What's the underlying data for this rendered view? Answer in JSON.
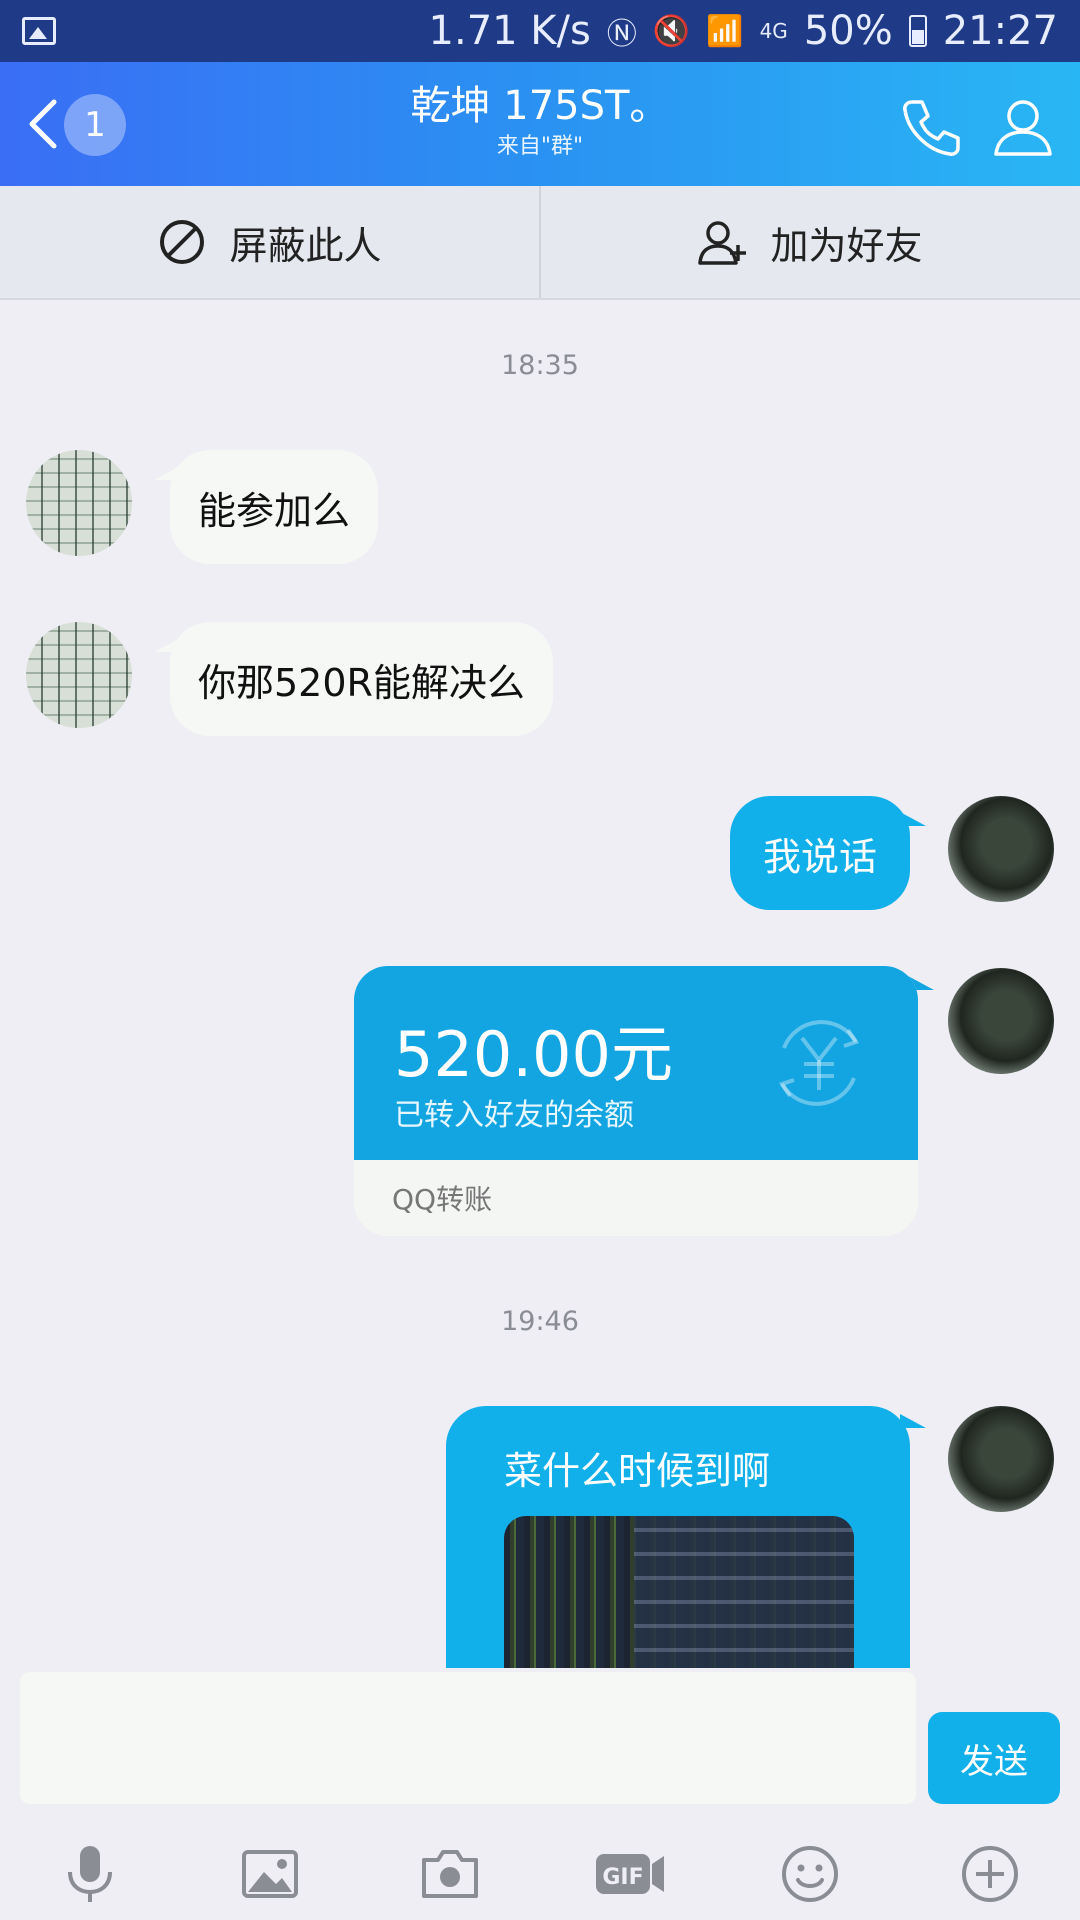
{
  "status_bar": {
    "network_speed": "1.71 K/s",
    "network_type": "4G",
    "battery": "50%",
    "time": "21:27"
  },
  "header": {
    "unread_count": "1",
    "title": "乾坤 175ST。",
    "subtitle": "来自\"群\""
  },
  "actions": {
    "block_label": "屏蔽此人",
    "add_friend_label": "加为好友"
  },
  "messages": {
    "time1": "18:35",
    "msg1": "能参加么",
    "msg2": "你那520R能解决么",
    "msg3": "我说话",
    "transfer": {
      "amount": "520.00元",
      "desc": "已转入好友的余额",
      "source": "QQ转账"
    },
    "time2": "19:46",
    "msg4": "菜什么时候到啊"
  },
  "input": {
    "send_label": "发送"
  },
  "colors": {
    "accent": "#12b0ea",
    "header_start": "#3a6ef5",
    "header_end": "#29b6f4"
  },
  "toolbar_icons": [
    "microphone-icon",
    "image-icon",
    "camera-icon",
    "gif-icon",
    "emoji-icon",
    "plus-icon"
  ]
}
